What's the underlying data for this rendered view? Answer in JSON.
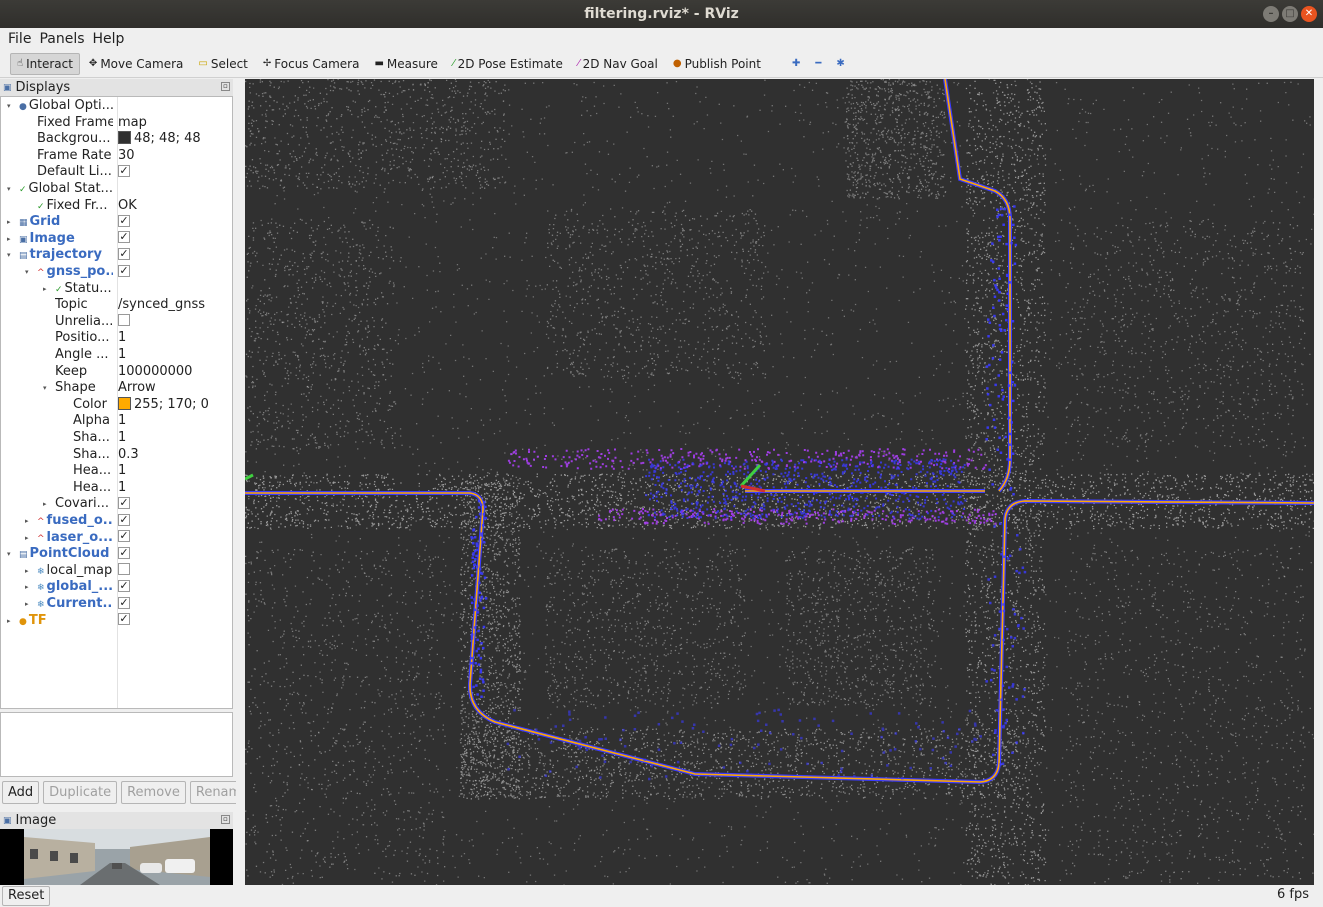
{
  "window": {
    "title": "filtering.rviz* - RViz"
  },
  "menubar": {
    "items": [
      "File",
      "Panels",
      "Help"
    ]
  },
  "toolbar": {
    "tools": [
      {
        "label": "Interact",
        "icon": "hand-icon",
        "active": true
      },
      {
        "label": "Move Camera",
        "icon": "move-icon",
        "active": false
      },
      {
        "label": "Select",
        "icon": "select-icon",
        "active": false
      },
      {
        "label": "Focus Camera",
        "icon": "focus-icon",
        "active": false
      },
      {
        "label": "Measure",
        "icon": "ruler-icon",
        "active": false
      },
      {
        "label": "2D Pose Estimate",
        "icon": "pose-arrow-icon",
        "active": false
      },
      {
        "label": "2D Nav Goal",
        "icon": "goal-arrow-icon",
        "active": false
      },
      {
        "label": "Publish Point",
        "icon": "pin-icon",
        "active": false
      }
    ],
    "extra": [
      "plus-icon",
      "minus-icon",
      "dot-menu-icon"
    ]
  },
  "displays": {
    "title": "Displays",
    "rows": [
      {
        "depth": 0,
        "expanded": true,
        "icon": "●",
        "icon_color": "#4a6fa5",
        "name": "Global Opti...",
        "style": "",
        "value": ""
      },
      {
        "depth": 1,
        "expanded": null,
        "icon": "",
        "name": "Fixed Frame",
        "style": "",
        "value": "map"
      },
      {
        "depth": 1,
        "expanded": null,
        "icon": "",
        "name": "Backgrou...",
        "style": "",
        "value": "48; 48; 48",
        "swatch": "#303030"
      },
      {
        "depth": 1,
        "expanded": null,
        "icon": "",
        "name": "Frame Rate",
        "style": "",
        "value": "30"
      },
      {
        "depth": 1,
        "expanded": null,
        "icon": "",
        "name": "Default Li...",
        "style": "",
        "check": "checked"
      },
      {
        "depth": 0,
        "expanded": true,
        "icon": "✓",
        "icon_color": "#2a9a2a",
        "name": "Global Stat...",
        "style": "",
        "value": ""
      },
      {
        "depth": 1,
        "expanded": null,
        "icon": "✓",
        "icon_color": "#2a9a2a",
        "name": "Fixed Fr...",
        "style": "",
        "value": "OK"
      },
      {
        "depth": 0,
        "expanded": false,
        "icon": "▦",
        "icon_color": "#4a6fa5",
        "name": "Grid",
        "style": "blue",
        "check": "checked"
      },
      {
        "depth": 0,
        "expanded": false,
        "icon": "▣",
        "icon_color": "#4a6fa5",
        "name": "Image",
        "style": "blue",
        "check": "checked"
      },
      {
        "depth": 0,
        "expanded": true,
        "icon": "▤",
        "icon_color": "#4a6fa5",
        "name": "trajectory",
        "style": "blue",
        "check": "checked"
      },
      {
        "depth": 1,
        "expanded": true,
        "icon": "^",
        "icon_color": "#d03030",
        "name": "gnss_po...",
        "style": "blue",
        "check": "checked"
      },
      {
        "depth": 2,
        "expanded": false,
        "icon": "✓",
        "icon_color": "#2a9a2a",
        "name": "Statu...",
        "style": "",
        "value": ""
      },
      {
        "depth": 2,
        "expanded": null,
        "icon": "",
        "name": "Topic",
        "style": "",
        "value": "/synced_gnss"
      },
      {
        "depth": 2,
        "expanded": null,
        "icon": "",
        "name": "Unrelia...",
        "style": "",
        "check": "unchecked"
      },
      {
        "depth": 2,
        "expanded": null,
        "icon": "",
        "name": "Positio...",
        "style": "",
        "value": "1"
      },
      {
        "depth": 2,
        "expanded": null,
        "icon": "",
        "name": "Angle ...",
        "style": "",
        "value": "1"
      },
      {
        "depth": 2,
        "expanded": null,
        "icon": "",
        "name": "Keep",
        "style": "",
        "value": "100000000"
      },
      {
        "depth": 2,
        "expanded": true,
        "icon": "",
        "name": "Shape",
        "style": "",
        "value": "Arrow"
      },
      {
        "depth": 3,
        "expanded": null,
        "icon": "",
        "name": "Color",
        "style": "",
        "value": "255; 170; 0",
        "swatch": "#ffaa00"
      },
      {
        "depth": 3,
        "expanded": null,
        "icon": "",
        "name": "Alpha",
        "style": "",
        "value": "1"
      },
      {
        "depth": 3,
        "expanded": null,
        "icon": "",
        "name": "Sha...",
        "style": "",
        "value": "1"
      },
      {
        "depth": 3,
        "expanded": null,
        "icon": "",
        "name": "Sha...",
        "style": "",
        "value": "0.3"
      },
      {
        "depth": 3,
        "expanded": null,
        "icon": "",
        "name": "Hea...",
        "style": "",
        "value": "1"
      },
      {
        "depth": 3,
        "expanded": null,
        "icon": "",
        "name": "Hea...",
        "style": "",
        "value": "1"
      },
      {
        "depth": 2,
        "expanded": false,
        "icon": "",
        "name": "Covari...",
        "style": "",
        "check": "checked"
      },
      {
        "depth": 1,
        "expanded": false,
        "icon": "^",
        "icon_color": "#d03030",
        "name": "fused_o...",
        "style": "blue",
        "check": "checked"
      },
      {
        "depth": 1,
        "expanded": false,
        "icon": "^",
        "icon_color": "#d03030",
        "name": "laser_o...",
        "style": "blue",
        "check": "checked"
      },
      {
        "depth": 0,
        "expanded": true,
        "icon": "▤",
        "icon_color": "#4a6fa5",
        "name": "PointCloud",
        "style": "blue",
        "check": "checked"
      },
      {
        "depth": 1,
        "expanded": false,
        "icon": "❄",
        "icon_color": "#4a8ac0",
        "name": "local_map",
        "style": "",
        "check": "unchecked"
      },
      {
        "depth": 1,
        "expanded": false,
        "icon": "❄",
        "icon_color": "#4a8ac0",
        "name": "global_...",
        "style": "blue",
        "check": "checked"
      },
      {
        "depth": 1,
        "expanded": false,
        "icon": "❄",
        "icon_color": "#4a8ac0",
        "name": "Current...",
        "style": "blue",
        "check": "checked"
      },
      {
        "depth": 0,
        "expanded": false,
        "icon": "●",
        "icon_color": "#e0940a",
        "name": "TF",
        "style": "orange",
        "check": "checked"
      }
    ],
    "buttons": {
      "add": "Add",
      "duplicate": "Duplicate",
      "remove": "Remove",
      "rename": "Rename"
    }
  },
  "image_panel": {
    "title": "Image"
  },
  "status": {
    "reset": "Reset",
    "fps": "6 fps"
  },
  "colors": {
    "background": "#303030",
    "trajectory": "#ffaa00",
    "points": "#c8c8c8",
    "laser": "#3a3aff",
    "scan": "#b040ff"
  }
}
